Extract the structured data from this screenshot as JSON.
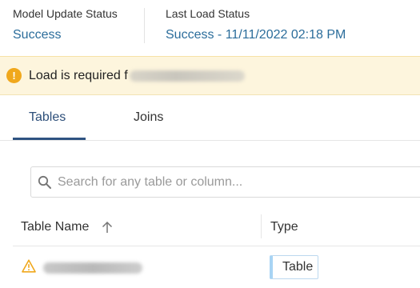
{
  "status": {
    "model_update": {
      "label": "Model Update Status",
      "value": "Success"
    },
    "last_load": {
      "label": "Last Load Status",
      "value": "Success - 11/11/2022 02:18 PM"
    }
  },
  "alert": {
    "icon": "exclamation-circle-icon",
    "text": "Load is required f"
  },
  "tabs": [
    {
      "label": "Tables",
      "active": true
    },
    {
      "label": "Joins",
      "active": false
    }
  ],
  "search": {
    "placeholder": "Search for any table or column...",
    "value": ""
  },
  "table": {
    "columns": [
      {
        "label": "Table Name",
        "sort": "ascending"
      },
      {
        "label": "Type"
      }
    ],
    "rows": [
      {
        "icon": "warning-triangle-icon",
        "type": "Table"
      }
    ]
  },
  "colors": {
    "link_blue": "#2b6d9b",
    "tab_active": "#2d4f7a",
    "alert_bg": "#fdf5dd",
    "warning_orange": "#f0a81c",
    "badge_accent": "#a8d4f4"
  }
}
